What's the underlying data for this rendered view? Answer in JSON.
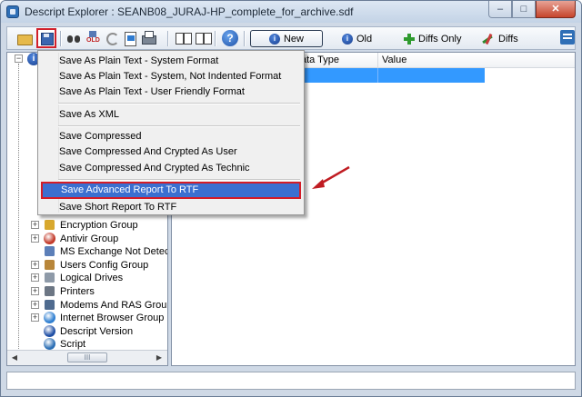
{
  "window": {
    "title": "Descript Explorer : SEANB08_JURAJ-HP_complete_for_archive.sdf",
    "controls": {
      "minimize": "–",
      "maximize": "□",
      "close": "✕"
    }
  },
  "toolbar": {
    "icons": [
      "open-folder-icon",
      "save-icon",
      "find-binoculars-icon",
      "open-old-icon",
      "refresh-icon",
      "report-icon",
      "print-icon",
      "compare-left-icon",
      "compare-right-icon",
      "help-icon",
      "app-logo-icon"
    ],
    "help_glyph": "?",
    "new_label": "New",
    "old_label": "Old",
    "old_small": "OLD",
    "diffs_only_label": "Diffs Only",
    "diffs_label": "Diffs",
    "info_glyph": "i"
  },
  "tree": {
    "root_glyph": "i",
    "expand_glyph": "+",
    "collapse_glyph": "−",
    "items": [
      {
        "label": "Encryption Group",
        "icon": "lock-icon",
        "expandable": true
      },
      {
        "label": "Antivir Group",
        "icon": "antivirus-icon",
        "expandable": true
      },
      {
        "label": "MS Exchange Not Detecte",
        "icon": "exchange-icon",
        "expandable": false
      },
      {
        "label": "Users Config Group",
        "icon": "users-icon",
        "expandable": true
      },
      {
        "label": "Logical Drives",
        "icon": "drive-icon",
        "expandable": true
      },
      {
        "label": "Printers",
        "icon": "printer-icon",
        "expandable": true
      },
      {
        "label": "Modems And RAS Group",
        "icon": "modem-icon",
        "expandable": true
      },
      {
        "label": "Internet Browser Group",
        "icon": "browser-icon",
        "expandable": true
      },
      {
        "label": "Descript Version",
        "icon": "info-icon",
        "expandable": false
      },
      {
        "label": "Script",
        "icon": "script-icon",
        "expandable": false
      }
    ],
    "scrollbar": {
      "left": "◀",
      "right": "▶",
      "thumb": "III"
    }
  },
  "grid": {
    "columns": [
      "ata Type",
      "Value"
    ]
  },
  "menu": {
    "items": [
      "Save As Plain Text - System Format",
      "Save As Plain Text - System, Not Indented Format",
      "Save As Plain Text - User Friendly Format",
      "Save As XML",
      "Save Compressed",
      "Save Compressed And Crypted As User",
      "Save Compressed And Crypted As Technic",
      "Save Advanced Report To RTF",
      "Save Short Report To RTF"
    ]
  },
  "colors": {
    "highlight": "#3b6fd0",
    "annotation_red": "#d41c27",
    "selection_blue": "#3399ff"
  }
}
